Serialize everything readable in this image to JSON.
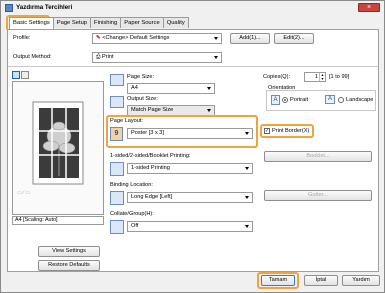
{
  "window": {
    "title": "Yazdırma Tercihleri",
    "close_label": "×"
  },
  "tabs": [
    "Basic Settings",
    "Page Setup",
    "Finishing",
    "Paper Source",
    "Quality"
  ],
  "profile": {
    "label": "Profile:",
    "value": "<Change> Default Settings",
    "add_label": "Add(1)...",
    "edit_label": "Edit(2)..."
  },
  "output_method": {
    "label": "Output Method:",
    "value": "Print"
  },
  "preview": {
    "caption": "A4 [Scaling: Auto]"
  },
  "left_buttons": {
    "view_settings": "View Settings",
    "restore_defaults": "Restore Defaults"
  },
  "page_size": {
    "label": "Page Size:",
    "value": "A4"
  },
  "output_size": {
    "label": "Output Size:",
    "value": "Match Page Size"
  },
  "page_layout": {
    "label": "Page Layout:",
    "value": "Poster [3 x 3]",
    "icon_text": "9"
  },
  "sided_printing": {
    "label": "1-sided/2-sided/Booklet Printing:",
    "value": "1-sided Printing",
    "booklet_label": "Booklet..."
  },
  "binding": {
    "label": "Binding Location:",
    "value": "Long Edge [Left]",
    "gutter_label": "Gutter..."
  },
  "collate": {
    "label": "Collate/Group(H):",
    "value": "Off"
  },
  "copies": {
    "label": "Copies(Q):",
    "value": "1",
    "range": "[1 to 99]"
  },
  "orientation": {
    "label": "Orientation",
    "portrait": "Portrait",
    "landscape": "Landscape",
    "selected": "portrait"
  },
  "print_border": {
    "label": "Print Border(X)",
    "checked": true,
    "mark": "✓"
  },
  "footer": {
    "ok": "Tamam",
    "cancel": "İptal",
    "help": "Yardım"
  }
}
